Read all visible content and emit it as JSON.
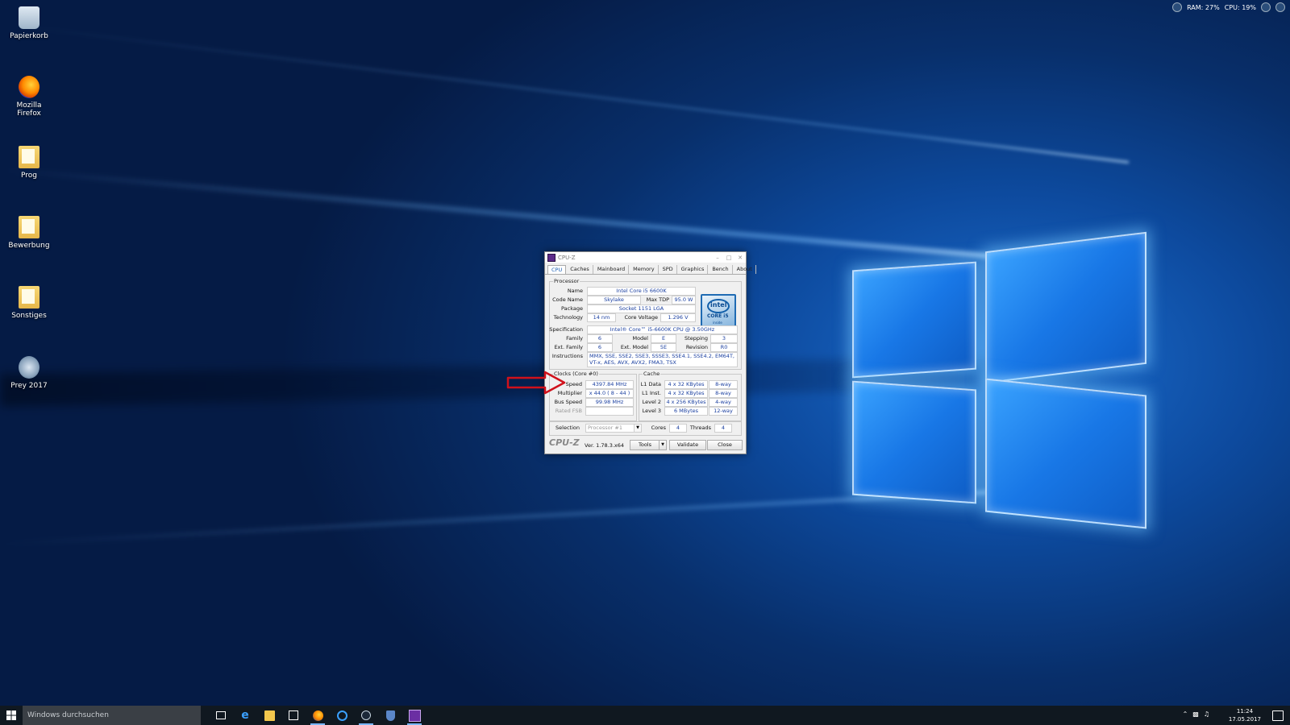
{
  "desktop_icons": [
    {
      "label": "Papierkorb",
      "icon": "recycle-bin-icon"
    },
    {
      "label": "Mozilla Firefox",
      "icon": "firefox-icon"
    },
    {
      "label": "Prog",
      "icon": "folder-icon"
    },
    {
      "label": "Bewerbung",
      "icon": "folder-icon"
    },
    {
      "label": "Sonstiges",
      "icon": "folder-icon"
    },
    {
      "label": "Prey 2017",
      "icon": "prey-icon"
    }
  ],
  "top_tray": {
    "ram": "RAM: 27%",
    "cpu": "CPU: 19%"
  },
  "cpuz": {
    "title": "CPU-Z",
    "tabs": [
      "CPU",
      "Caches",
      "Mainboard",
      "Memory",
      "SPD",
      "Graphics",
      "Bench",
      "About"
    ],
    "active_tab": "CPU",
    "processor": {
      "group_label": "Processor",
      "name_label": "Name",
      "name": "Intel Core i5 6600K",
      "code_name_label": "Code Name",
      "code_name": "Skylake",
      "max_tdp_label": "Max TDP",
      "max_tdp": "95.0 W",
      "package_label": "Package",
      "package": "Socket 1151 LGA",
      "technology_label": "Technology",
      "technology": "14 nm",
      "core_voltage_label": "Core Voltage",
      "core_voltage": "1.296 V",
      "specification_label": "Specification",
      "specification": "Intel® Core™ i5-6600K CPU @ 3.50GHz",
      "family_label": "Family",
      "family": "6",
      "model_label": "Model",
      "model": "E",
      "stepping_label": "Stepping",
      "stepping": "3",
      "ext_family_label": "Ext. Family",
      "ext_family": "6",
      "ext_model_label": "Ext. Model",
      "ext_model": "5E",
      "revision_label": "Revision",
      "revision": "R0",
      "instructions_label": "Instructions",
      "instructions": "MMX, SSE, SSE2, SSE3, SSSE3, SSE4.1, SSE4.2, EM64T, VT-x, AES, AVX, AVX2, FMA3, TSX",
      "logo": {
        "brand": "intel",
        "line": "CORE i5",
        "sub": "inside"
      }
    },
    "clocks": {
      "group_label": "Clocks (Core #0)",
      "core_speed_label": "Speed",
      "core_speed": "4397.84 MHz",
      "multiplier_label": "Multiplier",
      "multiplier": "x 44.0 ( 8 - 44 )",
      "bus_speed_label": "Bus Speed",
      "bus_speed": "99.98 MHz",
      "rated_fsb_label": "Rated FSB",
      "rated_fsb": ""
    },
    "cache": {
      "group_label": "Cache",
      "rows": [
        {
          "label": "L1 Data",
          "size": "4 x 32 KBytes",
          "way": "8-way"
        },
        {
          "label": "L1 Inst.",
          "size": "4 x 32 KBytes",
          "way": "8-way"
        },
        {
          "label": "Level 2",
          "size": "4 x 256 KBytes",
          "way": "4-way"
        },
        {
          "label": "Level 3",
          "size": "6 MBytes",
          "way": "12-way"
        }
      ]
    },
    "selection_label": "Selection",
    "selection": "Processor #1",
    "cores_label": "Cores",
    "cores": "4",
    "threads_label": "Threads",
    "threads": "4",
    "brand": "CPU-Z",
    "version": "Ver. 1.78.3.x64",
    "tools_label": "Tools",
    "validate_label": "Validate",
    "close_label": "Close"
  },
  "taskbar": {
    "search_placeholder": "Windows durchsuchen",
    "pinned": [
      "task-view-icon",
      "edge-icon",
      "file-explorer-icon",
      "store-icon",
      "firefox-icon",
      "ccleaner-icon",
      "steam-icon",
      "shield-icon",
      "cpuz-icon"
    ],
    "time": "11:24",
    "date": "17.05.2017"
  },
  "colors": {
    "accent": "#1a5fb4",
    "arrow": "#d0111b",
    "taskbar": "#101820"
  }
}
